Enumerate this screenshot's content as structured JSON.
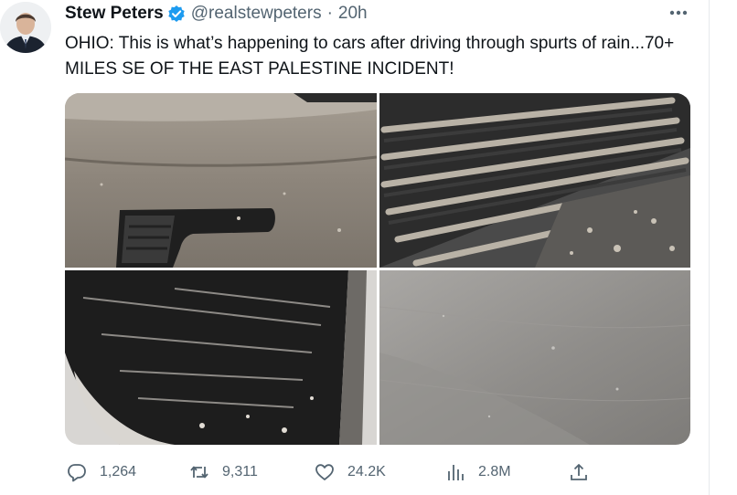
{
  "tweet": {
    "author": {
      "display_name": "Stew Peters",
      "verified": true,
      "handle": "@realstewpeters",
      "separator": "·",
      "time": "20h"
    },
    "text": "OHIO: This is what’s happening to cars after driving through spurts of rain...70+ MILES SE OF THE EAST PALESTINE INCIDENT!",
    "media": {
      "photo_count": 4
    },
    "actions": {
      "replies": "1,264",
      "retweets": "9,311",
      "likes": "24.2K",
      "views": "2.8M"
    }
  },
  "colors": {
    "text_primary": "#0f1419",
    "text_secondary": "#536471",
    "verified_badge": "#1d9bf0"
  },
  "icons": [
    "more-icon",
    "verified-badge-icon",
    "reply-icon",
    "retweet-icon",
    "like-icon",
    "views-icon",
    "share-icon"
  ]
}
